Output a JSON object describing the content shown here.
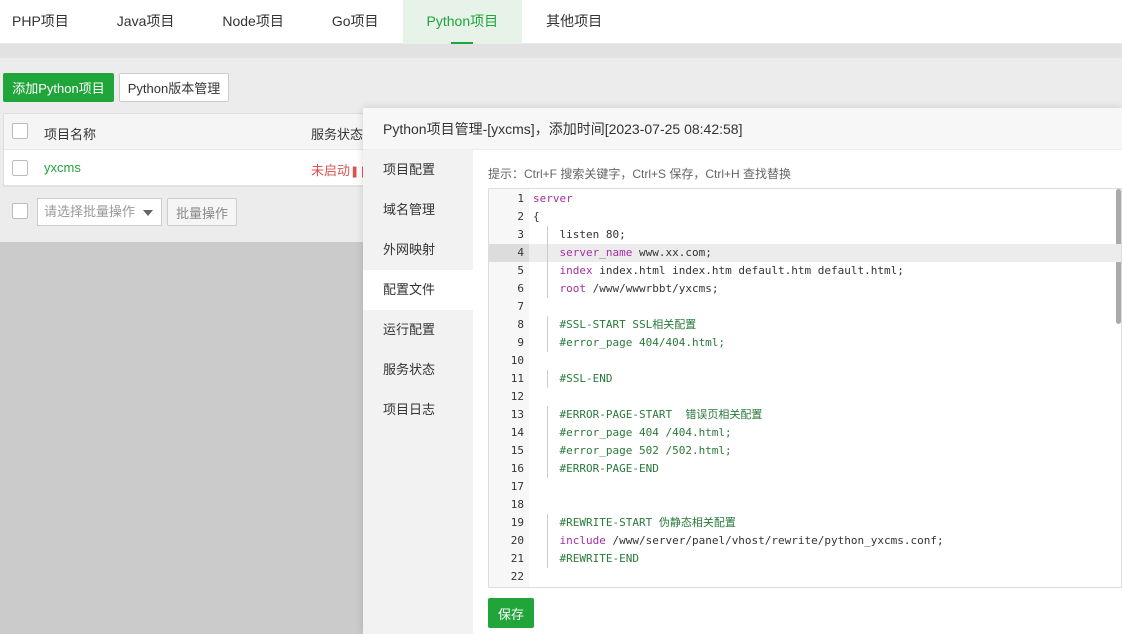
{
  "tabs": [
    {
      "label": "PHP项目",
      "active": false
    },
    {
      "label": "Java项目",
      "active": false
    },
    {
      "label": "Node项目",
      "active": false
    },
    {
      "label": "Go项目",
      "active": false
    },
    {
      "label": "Python项目",
      "active": true
    },
    {
      "label": "其他项目",
      "active": false
    }
  ],
  "toolbar": {
    "add_label": "添加Python项目",
    "version_label": "Python版本管理"
  },
  "table": {
    "col_name": "项目名称",
    "col_status": "服务状态",
    "rows": [
      {
        "name": "yxcms",
        "status": "未启动"
      }
    ]
  },
  "batch": {
    "placeholder": "请选择批量操作",
    "button": "批量操作"
  },
  "modal": {
    "title": "Python项目管理-[yxcms]，添加时间[2023-07-25 08:42:58]",
    "menu": [
      "项目配置",
      "域名管理",
      "外网映射",
      "配置文件",
      "运行配置",
      "服务状态",
      "项目日志"
    ],
    "active_menu": "配置文件",
    "tip": "提示：Ctrl+F 搜索关键字，Ctrl+S 保存，Ctrl+H 查找替换",
    "save_label": "保存",
    "editor_lines": [
      {
        "n": "1",
        "text": "server"
      },
      {
        "n": "2",
        "text": "{"
      },
      {
        "n": "3",
        "text": "    listen 80;"
      },
      {
        "n": "4",
        "text": "    server_name www.xx.com;"
      },
      {
        "n": "5",
        "text": "    index index.html index.htm default.htm default.html;"
      },
      {
        "n": "6",
        "text": "    root /www/wwwrbbt/yxcms;"
      },
      {
        "n": "7",
        "text": ""
      },
      {
        "n": "8",
        "text": "    #SSL-START SSL相关配置"
      },
      {
        "n": "9",
        "text": "    #error_page 404/404.html;"
      },
      {
        "n": "10",
        "text": ""
      },
      {
        "n": "11",
        "text": "    #SSL-END"
      },
      {
        "n": "12",
        "text": ""
      },
      {
        "n": "13",
        "text": "    #ERROR-PAGE-START  错误页相关配置"
      },
      {
        "n": "14",
        "text": "    #error_page 404 /404.html;"
      },
      {
        "n": "15",
        "text": "    #error_page 502 /502.html;"
      },
      {
        "n": "16",
        "text": "    #ERROR-PAGE-END"
      },
      {
        "n": "17",
        "text": ""
      },
      {
        "n": "18",
        "text": ""
      },
      {
        "n": "19",
        "text": "    #REWRITE-START 伪静态相关配置"
      },
      {
        "n": "20",
        "text": "    include /www/server/panel/vhost/rewrite/python_yxcms.conf;"
      },
      {
        "n": "21",
        "text": "    #REWRITE-END"
      },
      {
        "n": "22",
        "text": ""
      }
    ],
    "current_line": "4"
  },
  "colors": {
    "accent": "#20a53a",
    "stopped": "#d9534f",
    "keyword": "#a52fa5",
    "comment": "#2a7a3a"
  }
}
